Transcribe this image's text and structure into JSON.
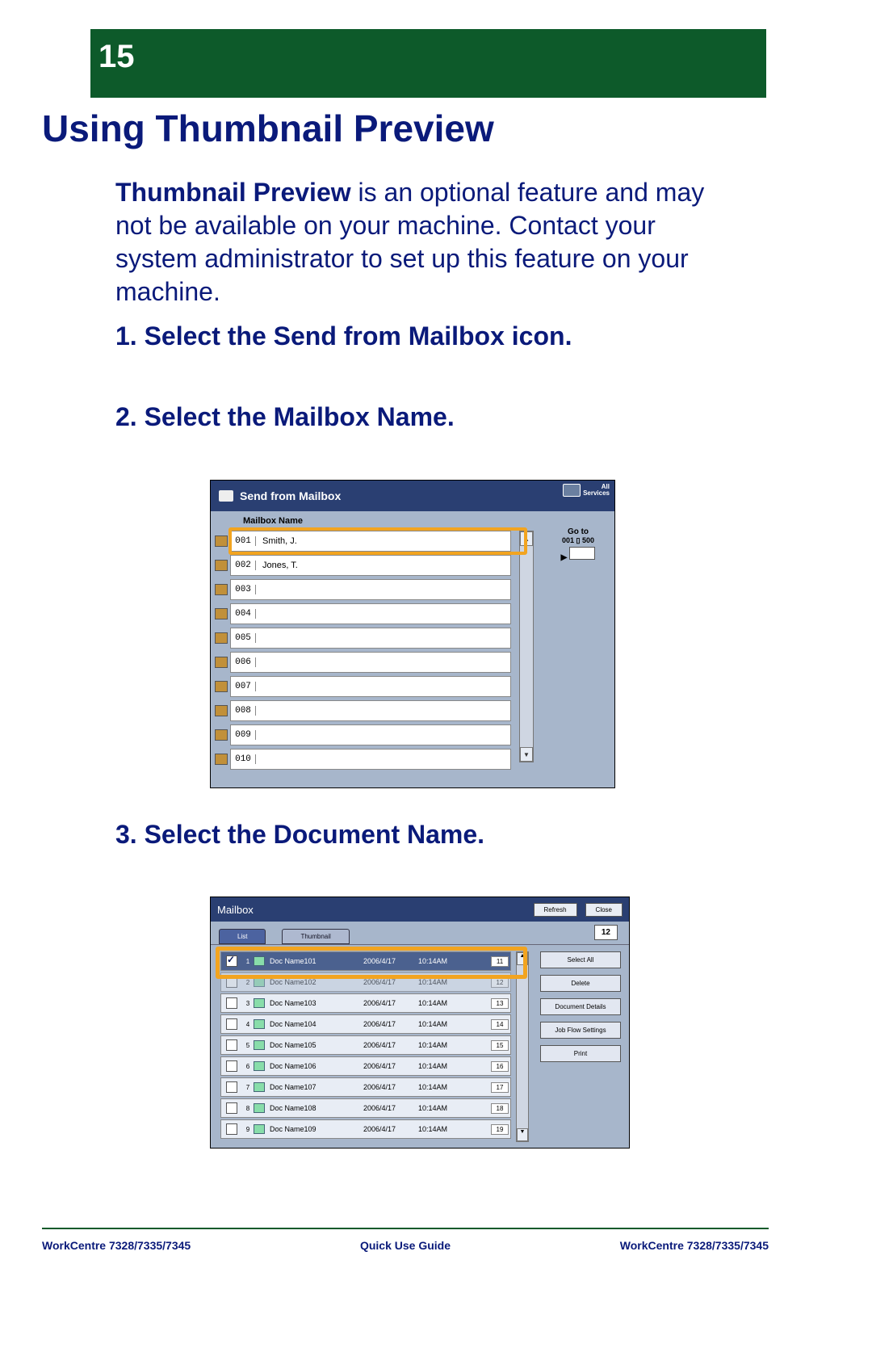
{
  "page_number": "15",
  "title": "Using Thumbnail Preview",
  "intro_bold": "Thumbnail Preview",
  "intro_rest": " is an optional feature and may not be available on your machine. Contact your system administrator to set up this feature on your machine.",
  "steps": {
    "s1": "1. Select the Send from Mailbox icon.",
    "s2": "2. Select the Mailbox Name.",
    "s3": "3. Select the Document Name."
  },
  "shot1": {
    "title": "Send from Mailbox",
    "all_services": "All\nServices",
    "col_header": "Mailbox Name",
    "goto_label": "Go to",
    "goto_range": "001 ▯ 500",
    "rows": [
      {
        "num": "001",
        "name": "Smith, J."
      },
      {
        "num": "002",
        "name": "Jones, T."
      },
      {
        "num": "003",
        "name": ""
      },
      {
        "num": "004",
        "name": ""
      },
      {
        "num": "005",
        "name": ""
      },
      {
        "num": "006",
        "name": ""
      },
      {
        "num": "007",
        "name": ""
      },
      {
        "num": "008",
        "name": ""
      },
      {
        "num": "009",
        "name": ""
      },
      {
        "num": "010",
        "name": ""
      }
    ]
  },
  "shot2": {
    "title": "Mailbox",
    "refresh": "Refresh",
    "close": "Close",
    "tab_list": "List",
    "tab_thumb": "Thumbnail",
    "count": "12",
    "side": {
      "select_all": "Select All",
      "delete": "Delete",
      "details": "Document Details",
      "jobflow": "Job Flow Settings",
      "print": "Print"
    },
    "docs": [
      {
        "i": "1",
        "n": "Doc Name101",
        "d": "2006/4/17",
        "t": "10:14AM",
        "p": "11",
        "sel": true
      },
      {
        "i": "2",
        "n": "Doc Name102",
        "d": "2006/4/17",
        "t": "10:14AM",
        "p": "12",
        "hid": true
      },
      {
        "i": "3",
        "n": "Doc Name103",
        "d": "2006/4/17",
        "t": "10:14AM",
        "p": "13"
      },
      {
        "i": "4",
        "n": "Doc Name104",
        "d": "2006/4/17",
        "t": "10:14AM",
        "p": "14"
      },
      {
        "i": "5",
        "n": "Doc Name105",
        "d": "2006/4/17",
        "t": "10:14AM",
        "p": "15"
      },
      {
        "i": "6",
        "n": "Doc Name106",
        "d": "2006/4/17",
        "t": "10:14AM",
        "p": "16"
      },
      {
        "i": "7",
        "n": "Doc Name107",
        "d": "2006/4/17",
        "t": "10:14AM",
        "p": "17"
      },
      {
        "i": "8",
        "n": "Doc Name108",
        "d": "2006/4/17",
        "t": "10:14AM",
        "p": "18"
      },
      {
        "i": "9",
        "n": "Doc Name109",
        "d": "2006/4/17",
        "t": "10:14AM",
        "p": "19"
      }
    ]
  },
  "footer": {
    "left": "WorkCentre 7328/7335/7345",
    "center": "Quick Use Guide",
    "right": "WorkCentre 7328/7335/7345"
  }
}
